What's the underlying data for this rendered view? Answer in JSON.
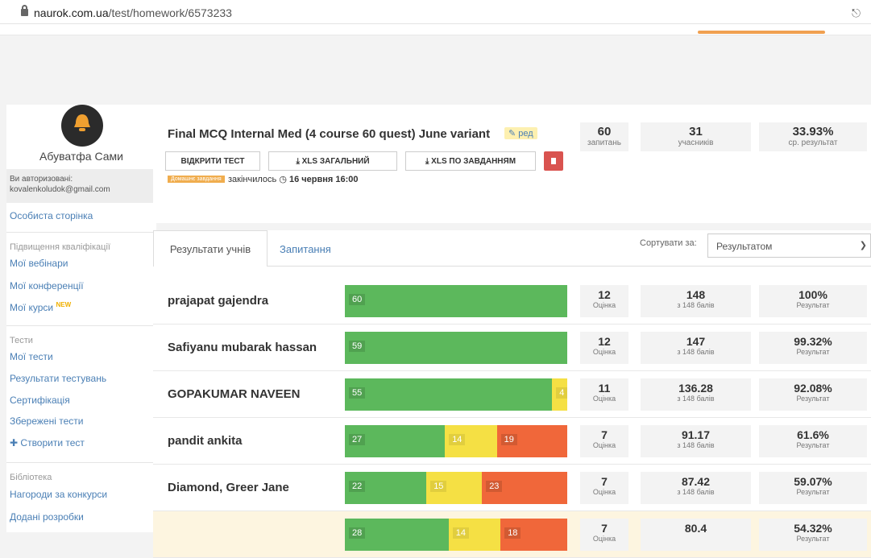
{
  "browser": {
    "url_host": "naurok.com.ua",
    "url_path": "/test/homework/6573233"
  },
  "sidebar": {
    "user_name": "Абуватфа Сами",
    "auth_label": "Ви авторизовані:",
    "auth_email": "kovalenkoludok@gmail.com",
    "personal_page": "Особиста сторінка",
    "section_qualification": "Підвищення кваліфікації",
    "webinars": "Мої вебінари",
    "conferences": "Мої конференції",
    "courses": "Мої курси",
    "courses_badge": "NEW",
    "section_tests": "Тести",
    "my_tests": "Мої тести",
    "test_results": "Результати тестувань",
    "certification": "Сертифікація",
    "saved_tests": "Збережені тести",
    "create_test": "Створити тест",
    "section_library": "Бібліотека",
    "contest_awards": "Нагороди за конкурси",
    "added_materials": "Додані розробки"
  },
  "test": {
    "title": "Final MCQ Internal Med (4 course 60 quest) June variant",
    "edit_label": "ред",
    "open_button": "ВІДКРИТИ ТЕСТ",
    "xls_total_button": "XLS ЗАГАЛЬНИЙ",
    "xls_tasks_button": "XLS ПО ЗАВДАННЯМ",
    "homework_badge": "Домашнє завдання",
    "closed_text": "закінчилось",
    "closed_date": "16 червня 16:00",
    "stats": [
      {
        "value": "60",
        "label": "запитань"
      },
      {
        "value": "31",
        "label": "учасників"
      },
      {
        "value": "33.93%",
        "label": "ср. результат"
      }
    ]
  },
  "results": {
    "tab_students": "Результати учнів",
    "tab_questions": "Запитання",
    "sort_label": "Сортувати за:",
    "sort_value": "Результатом",
    "grade_label": "Оцінка",
    "result_label": "Результат",
    "rows": [
      {
        "name": "prajapat gajendra",
        "correct": 60,
        "partial": 0,
        "wrong": 0,
        "grade": "12",
        "points": "148",
        "points_of": "з 148 балів",
        "percent": "100%"
      },
      {
        "name": "Safiyanu mubarak hassan",
        "correct": 59,
        "partial": 0,
        "wrong": 0,
        "grade": "12",
        "points": "147",
        "points_of": "з 148 балів",
        "percent": "99.32%"
      },
      {
        "name": "GOPAKUMAR NAVEEN",
        "correct": 55,
        "partial": 4,
        "wrong": 0,
        "grade": "11",
        "points": "136.28",
        "points_of": "з 148 балів",
        "percent": "92.08%"
      },
      {
        "name": "pandit ankita",
        "correct": 27,
        "partial": 14,
        "wrong": 19,
        "grade": "7",
        "points": "91.17",
        "points_of": "з 148 балів",
        "percent": "61.6%"
      },
      {
        "name": "Diamond, Greer Jane",
        "correct": 22,
        "partial": 15,
        "wrong": 23,
        "grade": "7",
        "points": "87.42",
        "points_of": "з 148 балів",
        "percent": "59.07%"
      },
      {
        "name": "",
        "correct": 28,
        "partial": 14,
        "wrong": 18,
        "grade": "7",
        "points": "80.4",
        "points_of": "",
        "percent": "54.32%"
      }
    ]
  }
}
